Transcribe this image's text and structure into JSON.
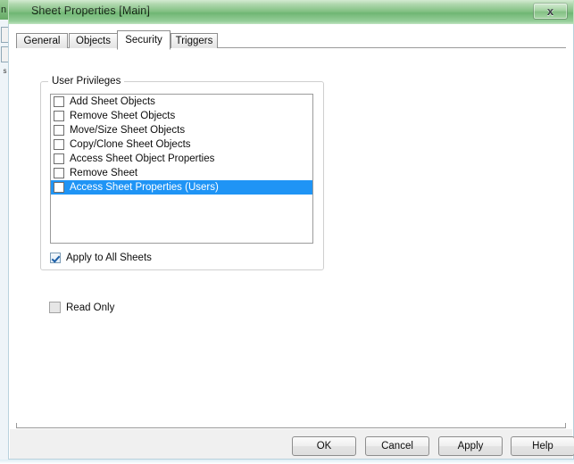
{
  "background_window": {
    "title_fragment": "n",
    "strip_label": "s"
  },
  "window": {
    "title": "Sheet Properties [Main]",
    "close_button_label": "x",
    "close_icon": "close-icon"
  },
  "tabs": [
    {
      "label": "General",
      "active": false
    },
    {
      "label": "Objects",
      "active": false
    },
    {
      "label": "Security",
      "active": true
    },
    {
      "label": "Triggers",
      "active": false
    }
  ],
  "security_panel": {
    "group": {
      "legend": "User Privileges",
      "privileges": [
        {
          "label": "Add Sheet Objects",
          "checked": false,
          "selected": false
        },
        {
          "label": "Remove Sheet Objects",
          "checked": false,
          "selected": false
        },
        {
          "label": "Move/Size Sheet Objects",
          "checked": false,
          "selected": false
        },
        {
          "label": "Copy/Clone Sheet Objects",
          "checked": false,
          "selected": false
        },
        {
          "label": "Access Sheet Object Properties",
          "checked": false,
          "selected": false
        },
        {
          "label": "Remove Sheet",
          "checked": false,
          "selected": false
        },
        {
          "label": "Access Sheet Properties (Users)",
          "checked": false,
          "selected": true
        }
      ],
      "apply_to_all": {
        "label": "Apply to All Sheets",
        "checked": true
      }
    },
    "read_only": {
      "label": "Read Only",
      "checked": false,
      "disabled": true
    }
  },
  "footer": {
    "buttons": [
      {
        "label": "OK"
      },
      {
        "label": "Cancel"
      },
      {
        "label": "Apply"
      },
      {
        "label": "Help"
      }
    ]
  },
  "colors": {
    "titlebar_green": "#7cbd7d",
    "selection_blue": "#1f94f5",
    "dialog_face": "#f0f0f0",
    "client_white": "#ffffff",
    "border_gray": "#9a9a9a"
  }
}
